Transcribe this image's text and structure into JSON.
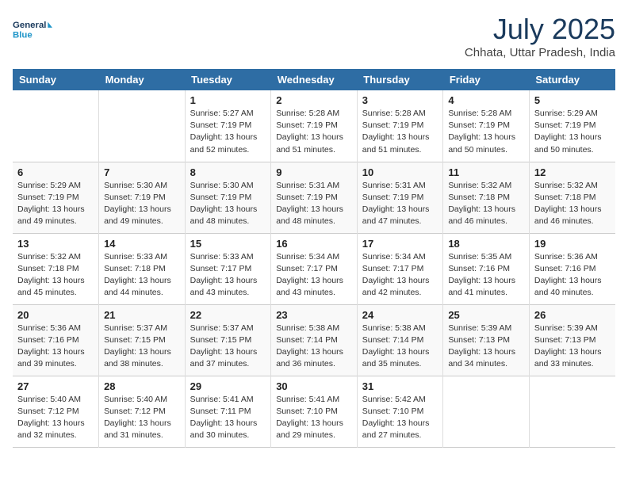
{
  "logo": {
    "line1": "General",
    "line2": "Blue"
  },
  "title": "July 2025",
  "location": "Chhata, Uttar Pradesh, India",
  "days_header": [
    "Sunday",
    "Monday",
    "Tuesday",
    "Wednesday",
    "Thursday",
    "Friday",
    "Saturday"
  ],
  "weeks": [
    [
      {
        "day": "",
        "info": ""
      },
      {
        "day": "",
        "info": ""
      },
      {
        "day": "1",
        "info": "Sunrise: 5:27 AM\nSunset: 7:19 PM\nDaylight: 13 hours\nand 52 minutes."
      },
      {
        "day": "2",
        "info": "Sunrise: 5:28 AM\nSunset: 7:19 PM\nDaylight: 13 hours\nand 51 minutes."
      },
      {
        "day": "3",
        "info": "Sunrise: 5:28 AM\nSunset: 7:19 PM\nDaylight: 13 hours\nand 51 minutes."
      },
      {
        "day": "4",
        "info": "Sunrise: 5:28 AM\nSunset: 7:19 PM\nDaylight: 13 hours\nand 50 minutes."
      },
      {
        "day": "5",
        "info": "Sunrise: 5:29 AM\nSunset: 7:19 PM\nDaylight: 13 hours\nand 50 minutes."
      }
    ],
    [
      {
        "day": "6",
        "info": "Sunrise: 5:29 AM\nSunset: 7:19 PM\nDaylight: 13 hours\nand 49 minutes."
      },
      {
        "day": "7",
        "info": "Sunrise: 5:30 AM\nSunset: 7:19 PM\nDaylight: 13 hours\nand 49 minutes."
      },
      {
        "day": "8",
        "info": "Sunrise: 5:30 AM\nSunset: 7:19 PM\nDaylight: 13 hours\nand 48 minutes."
      },
      {
        "day": "9",
        "info": "Sunrise: 5:31 AM\nSunset: 7:19 PM\nDaylight: 13 hours\nand 48 minutes."
      },
      {
        "day": "10",
        "info": "Sunrise: 5:31 AM\nSunset: 7:19 PM\nDaylight: 13 hours\nand 47 minutes."
      },
      {
        "day": "11",
        "info": "Sunrise: 5:32 AM\nSunset: 7:18 PM\nDaylight: 13 hours\nand 46 minutes."
      },
      {
        "day": "12",
        "info": "Sunrise: 5:32 AM\nSunset: 7:18 PM\nDaylight: 13 hours\nand 46 minutes."
      }
    ],
    [
      {
        "day": "13",
        "info": "Sunrise: 5:32 AM\nSunset: 7:18 PM\nDaylight: 13 hours\nand 45 minutes."
      },
      {
        "day": "14",
        "info": "Sunrise: 5:33 AM\nSunset: 7:18 PM\nDaylight: 13 hours\nand 44 minutes."
      },
      {
        "day": "15",
        "info": "Sunrise: 5:33 AM\nSunset: 7:17 PM\nDaylight: 13 hours\nand 43 minutes."
      },
      {
        "day": "16",
        "info": "Sunrise: 5:34 AM\nSunset: 7:17 PM\nDaylight: 13 hours\nand 43 minutes."
      },
      {
        "day": "17",
        "info": "Sunrise: 5:34 AM\nSunset: 7:17 PM\nDaylight: 13 hours\nand 42 minutes."
      },
      {
        "day": "18",
        "info": "Sunrise: 5:35 AM\nSunset: 7:16 PM\nDaylight: 13 hours\nand 41 minutes."
      },
      {
        "day": "19",
        "info": "Sunrise: 5:36 AM\nSunset: 7:16 PM\nDaylight: 13 hours\nand 40 minutes."
      }
    ],
    [
      {
        "day": "20",
        "info": "Sunrise: 5:36 AM\nSunset: 7:16 PM\nDaylight: 13 hours\nand 39 minutes."
      },
      {
        "day": "21",
        "info": "Sunrise: 5:37 AM\nSunset: 7:15 PM\nDaylight: 13 hours\nand 38 minutes."
      },
      {
        "day": "22",
        "info": "Sunrise: 5:37 AM\nSunset: 7:15 PM\nDaylight: 13 hours\nand 37 minutes."
      },
      {
        "day": "23",
        "info": "Sunrise: 5:38 AM\nSunset: 7:14 PM\nDaylight: 13 hours\nand 36 minutes."
      },
      {
        "day": "24",
        "info": "Sunrise: 5:38 AM\nSunset: 7:14 PM\nDaylight: 13 hours\nand 35 minutes."
      },
      {
        "day": "25",
        "info": "Sunrise: 5:39 AM\nSunset: 7:13 PM\nDaylight: 13 hours\nand 34 minutes."
      },
      {
        "day": "26",
        "info": "Sunrise: 5:39 AM\nSunset: 7:13 PM\nDaylight: 13 hours\nand 33 minutes."
      }
    ],
    [
      {
        "day": "27",
        "info": "Sunrise: 5:40 AM\nSunset: 7:12 PM\nDaylight: 13 hours\nand 32 minutes."
      },
      {
        "day": "28",
        "info": "Sunrise: 5:40 AM\nSunset: 7:12 PM\nDaylight: 13 hours\nand 31 minutes."
      },
      {
        "day": "29",
        "info": "Sunrise: 5:41 AM\nSunset: 7:11 PM\nDaylight: 13 hours\nand 30 minutes."
      },
      {
        "day": "30",
        "info": "Sunrise: 5:41 AM\nSunset: 7:10 PM\nDaylight: 13 hours\nand 29 minutes."
      },
      {
        "day": "31",
        "info": "Sunrise: 5:42 AM\nSunset: 7:10 PM\nDaylight: 13 hours\nand 27 minutes."
      },
      {
        "day": "",
        "info": ""
      },
      {
        "day": "",
        "info": ""
      }
    ]
  ]
}
